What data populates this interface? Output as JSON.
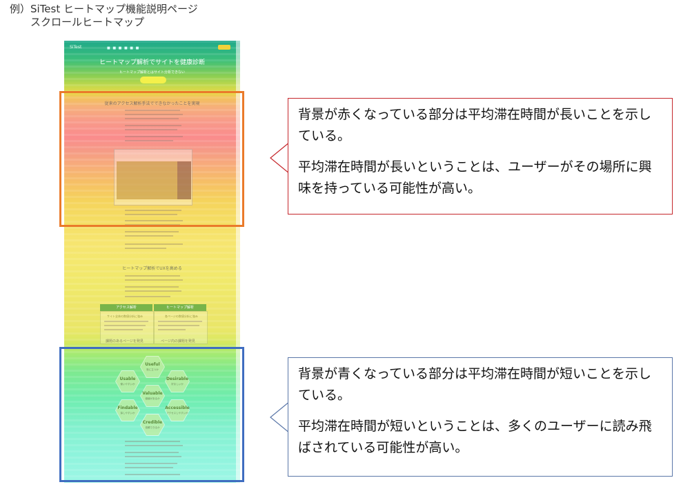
{
  "caption": {
    "line1": "例）SiTest ヒートマップ機能説明ページ",
    "line2": "スクロールヒートマップ"
  },
  "screenshot": {
    "logo": "SiTest",
    "nav": "■ ■ ■ ■ ■ ■",
    "hero_title": "ヒートマップ解析でサイトを健康診断",
    "hero_sub": "ヒートマップ解析とはサイト分析できない",
    "hero_button": "",
    "section1_title": "従来のアクセス解析手法でできなかったことを実現",
    "section2_title": "ヒートマップ解析でUXを高める",
    "table": {
      "col1_header": "アクセス解析",
      "col2_header": "ヒートマップ解析",
      "col1_sub": "サイト全体の数値分析に強み",
      "col2_sub": "各ページの数値分析に強み",
      "col1_footer": "課題のあるページを発見",
      "col2_footer": "ページ内の課題を発見"
    },
    "hexagons": [
      {
        "label": "Useful",
        "sub": "役に立つか"
      },
      {
        "label": "Usable",
        "sub": "使いやすいか"
      },
      {
        "label": "Desirable",
        "sub": "好ましいか"
      },
      {
        "label": "Valuable",
        "sub": "価値があるか"
      },
      {
        "label": "Findable",
        "sub": "探しやすいか"
      },
      {
        "label": "Accessible",
        "sub": "アクセスしやすいか"
      },
      {
        "label": "Credible",
        "sub": "信頼できるか"
      }
    ]
  },
  "colors": {
    "orange_box": "#ea7a2a",
    "blue_box": "#3f6dc0",
    "red_callout": "#c5252a",
    "blue_callout": "#5a76a8"
  },
  "callout_red": {
    "para1": "背景が赤くなっている部分は平均滞在時間が長いことを示している。",
    "para2": "平均滞在時間が長いということは、ユーザーがその場所に興味を持っている可能性が高い。"
  },
  "callout_blue": {
    "para1": "背景が青くなっている部分は平均滞在時間が短いことを示している。",
    "para2": "平均滞在時間が短いということは、多くのユーザーに読み飛ばされている可能性が高い。"
  }
}
